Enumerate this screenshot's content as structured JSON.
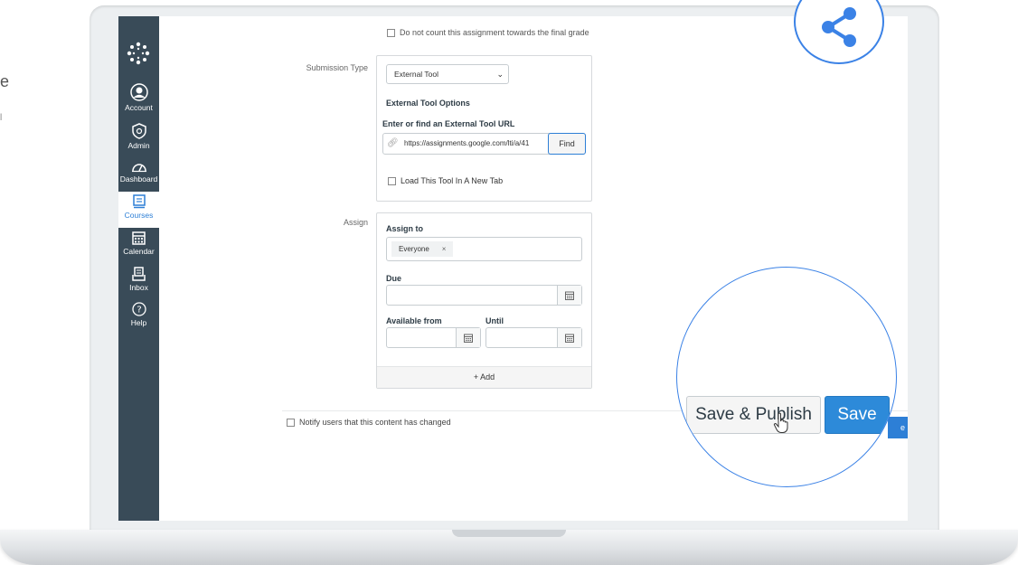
{
  "left_fragments": {
    "line1": "e",
    "line2": "l"
  },
  "sidebar": {
    "items": [
      {
        "label": "Account",
        "icon": "account-icon"
      },
      {
        "label": "Admin",
        "icon": "admin-shield-icon"
      },
      {
        "label": "Dashboard",
        "icon": "dashboard-icon"
      },
      {
        "label": "Courses",
        "icon": "courses-icon",
        "active": true
      },
      {
        "label": "Calendar",
        "icon": "calendar-icon"
      },
      {
        "label": "Inbox",
        "icon": "inbox-icon"
      },
      {
        "label": "Help",
        "icon": "help-icon"
      }
    ]
  },
  "form": {
    "final_grade_checkbox": "Do not count this assignment towards the final grade",
    "submission_type_label": "Submission Type",
    "submission_type_value": "External Tool",
    "external_tool_options": "External Tool Options",
    "enter_url_label": "Enter or find an External Tool URL",
    "url_value": "https://assignments.google.com/lti/a/41",
    "find_button": "Find",
    "new_tab_checkbox": "Load This Tool In A New Tab",
    "assign_label": "Assign",
    "assign_to_label": "Assign to",
    "assignee_tag": "Everyone",
    "tag_remove": "×",
    "due_label": "Due",
    "available_from_label": "Available from",
    "until_label": "Until",
    "add_button": "+ Add",
    "notify_checkbox": "Notify users that this content has changed",
    "blue_fragment": "e"
  },
  "zoom": {
    "save_publish_button": "Save & Publish",
    "save_button": "Save"
  },
  "colors": {
    "sidebar": "#394b58",
    "accent": "#2d7fd6",
    "zoom_ring": "#3b82e6",
    "save_button": "#2d8ad9"
  },
  "share_badge": {
    "icon": "share-icon"
  }
}
